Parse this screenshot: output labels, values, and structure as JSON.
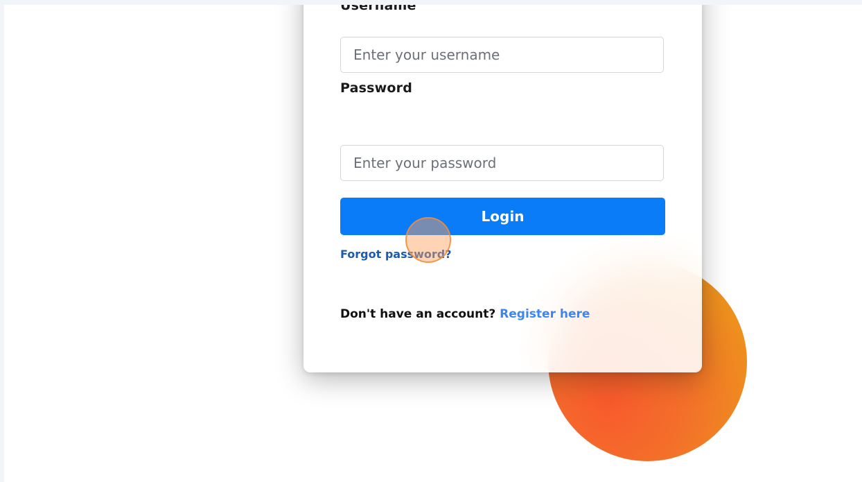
{
  "form": {
    "username_label": "Username",
    "username_placeholder": "Enter your username",
    "password_label": "Password",
    "password_placeholder": "Enter your password",
    "login_label": "Login",
    "forgot_label": "Forgot password?",
    "register_prompt": "Don't have an account?",
    "register_link": "Register here"
  },
  "colors": {
    "primary": "#0a7cf8",
    "link": "#1c5bb0",
    "register_link": "#3a86f2",
    "blob_start": "#f85a2c",
    "blob_end": "#e9a01c"
  }
}
